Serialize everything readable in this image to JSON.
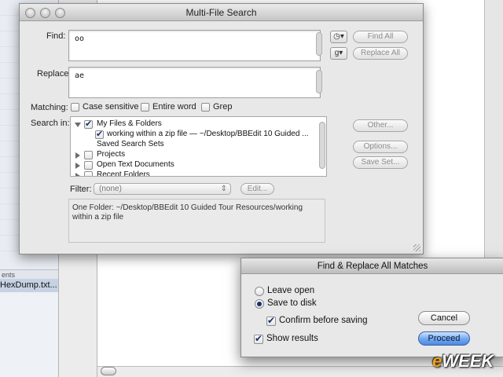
{
  "background": {
    "sidebar_header": "ents",
    "selected_file": "HexDump.txt..."
  },
  "dialog": {
    "title": "Multi-File Search",
    "find_label": "Find:",
    "find_value": "oo",
    "replace_label": "Replace:",
    "replace_value": "ae",
    "history_menu_icon": "clock-icon",
    "grep_menu_label": "g",
    "find_all_button": "Find All",
    "replace_all_button": "Replace All",
    "matching_label": "Matching:",
    "options": [
      {
        "label": "Case sensitive",
        "checked": false
      },
      {
        "label": "Entire word",
        "checked": false
      },
      {
        "label": "Grep",
        "checked": false
      }
    ],
    "search_in_label": "Search in:",
    "sources": [
      {
        "label": "My Files & Folders",
        "checked": true,
        "expanded": true
      },
      {
        "label": "working within a zip file — ~/Desktop/BBEdit 10 Guided ...",
        "checked": true,
        "child": true
      },
      {
        "label": "Saved Search Sets",
        "checked": null
      },
      {
        "label": "Projects",
        "checked": false,
        "expanded": false
      },
      {
        "label": "Open Text Documents",
        "checked": false,
        "expanded": false
      },
      {
        "label": "Recent Folders",
        "checked": false,
        "expanded": false
      }
    ],
    "other_button": "Other...",
    "options_button": "Options...",
    "save_set_button": "Save Set...",
    "filter_label": "Filter:",
    "filter_value": "(none)",
    "edit_button": "Edit...",
    "summary": "One Folder: ~/Desktop/BBEdit 10 Guided Tour Resources/working within a zip file"
  },
  "sheet": {
    "title": "Find & Replace All Matches",
    "leave_open": {
      "label": "Leave open",
      "selected": false
    },
    "save_to_disk": {
      "label": "Save to disk",
      "selected": true
    },
    "confirm_before_saving": {
      "label": "Confirm before saving",
      "checked": true
    },
    "show_results": {
      "label": "Show results",
      "checked": true
    },
    "cancel_button": "Cancel",
    "proceed_button": "Proceed"
  },
  "watermark": {
    "prefix": "e",
    "rest": "WEEK"
  },
  "colors": {
    "default_button": "#6fa6ee",
    "checkmark": "#1b2f6e"
  }
}
